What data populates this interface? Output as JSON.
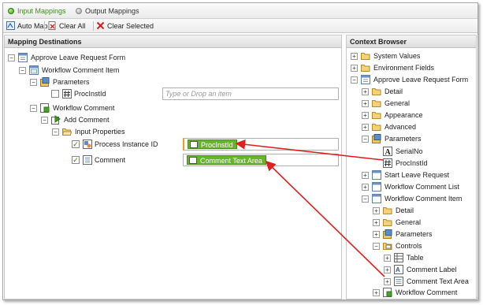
{
  "tabs": {
    "input": "Input Mappings",
    "output": "Output Mappings"
  },
  "toolbar": {
    "auto_map": "Auto Map",
    "clear_all": "Clear All",
    "clear_selected": "Clear Selected"
  },
  "left": {
    "title": "Mapping Destinations",
    "form": "Approve Leave Request Form",
    "wf_item": "Workflow Comment Item",
    "parameters": "Parameters",
    "procinstid": "ProcInstId",
    "procinstid_placeholder": "Type or Drop an item",
    "wf_comment": "Workflow Comment",
    "add_comment": "Add Comment",
    "input_props": "Input Properties",
    "process_instance_id": "Process Instance ID",
    "comment": "Comment",
    "mapped_procinstid": "ProcInstId",
    "mapped_comment": "Comment Text Area"
  },
  "right": {
    "title": "Context Browser",
    "system_values": "System Values",
    "environment_fields": "Environment Fields",
    "form": "Approve Leave Request Form",
    "detail": "Detail",
    "general": "General",
    "appearance": "Appearance",
    "advanced": "Advanced",
    "parameters": "Parameters",
    "serialno": "SerialNo",
    "procinstid": "ProcInstId",
    "start_leave": "Start Leave Request",
    "wf_comment_list": "Workflow Comment List",
    "wf_comment_item": "Workflow Comment Item",
    "detail2": "Detail",
    "general2": "General",
    "parameters2": "Parameters",
    "controls": "Controls",
    "table": "Table",
    "comment_label": "Comment Label",
    "comment_text_area": "Comment Text Area",
    "wf_comment": "Workflow Comment"
  },
  "colors": {
    "accent_green": "#69b52a",
    "arrow_red": "#e02020",
    "tab_active": "#3e8d19"
  }
}
